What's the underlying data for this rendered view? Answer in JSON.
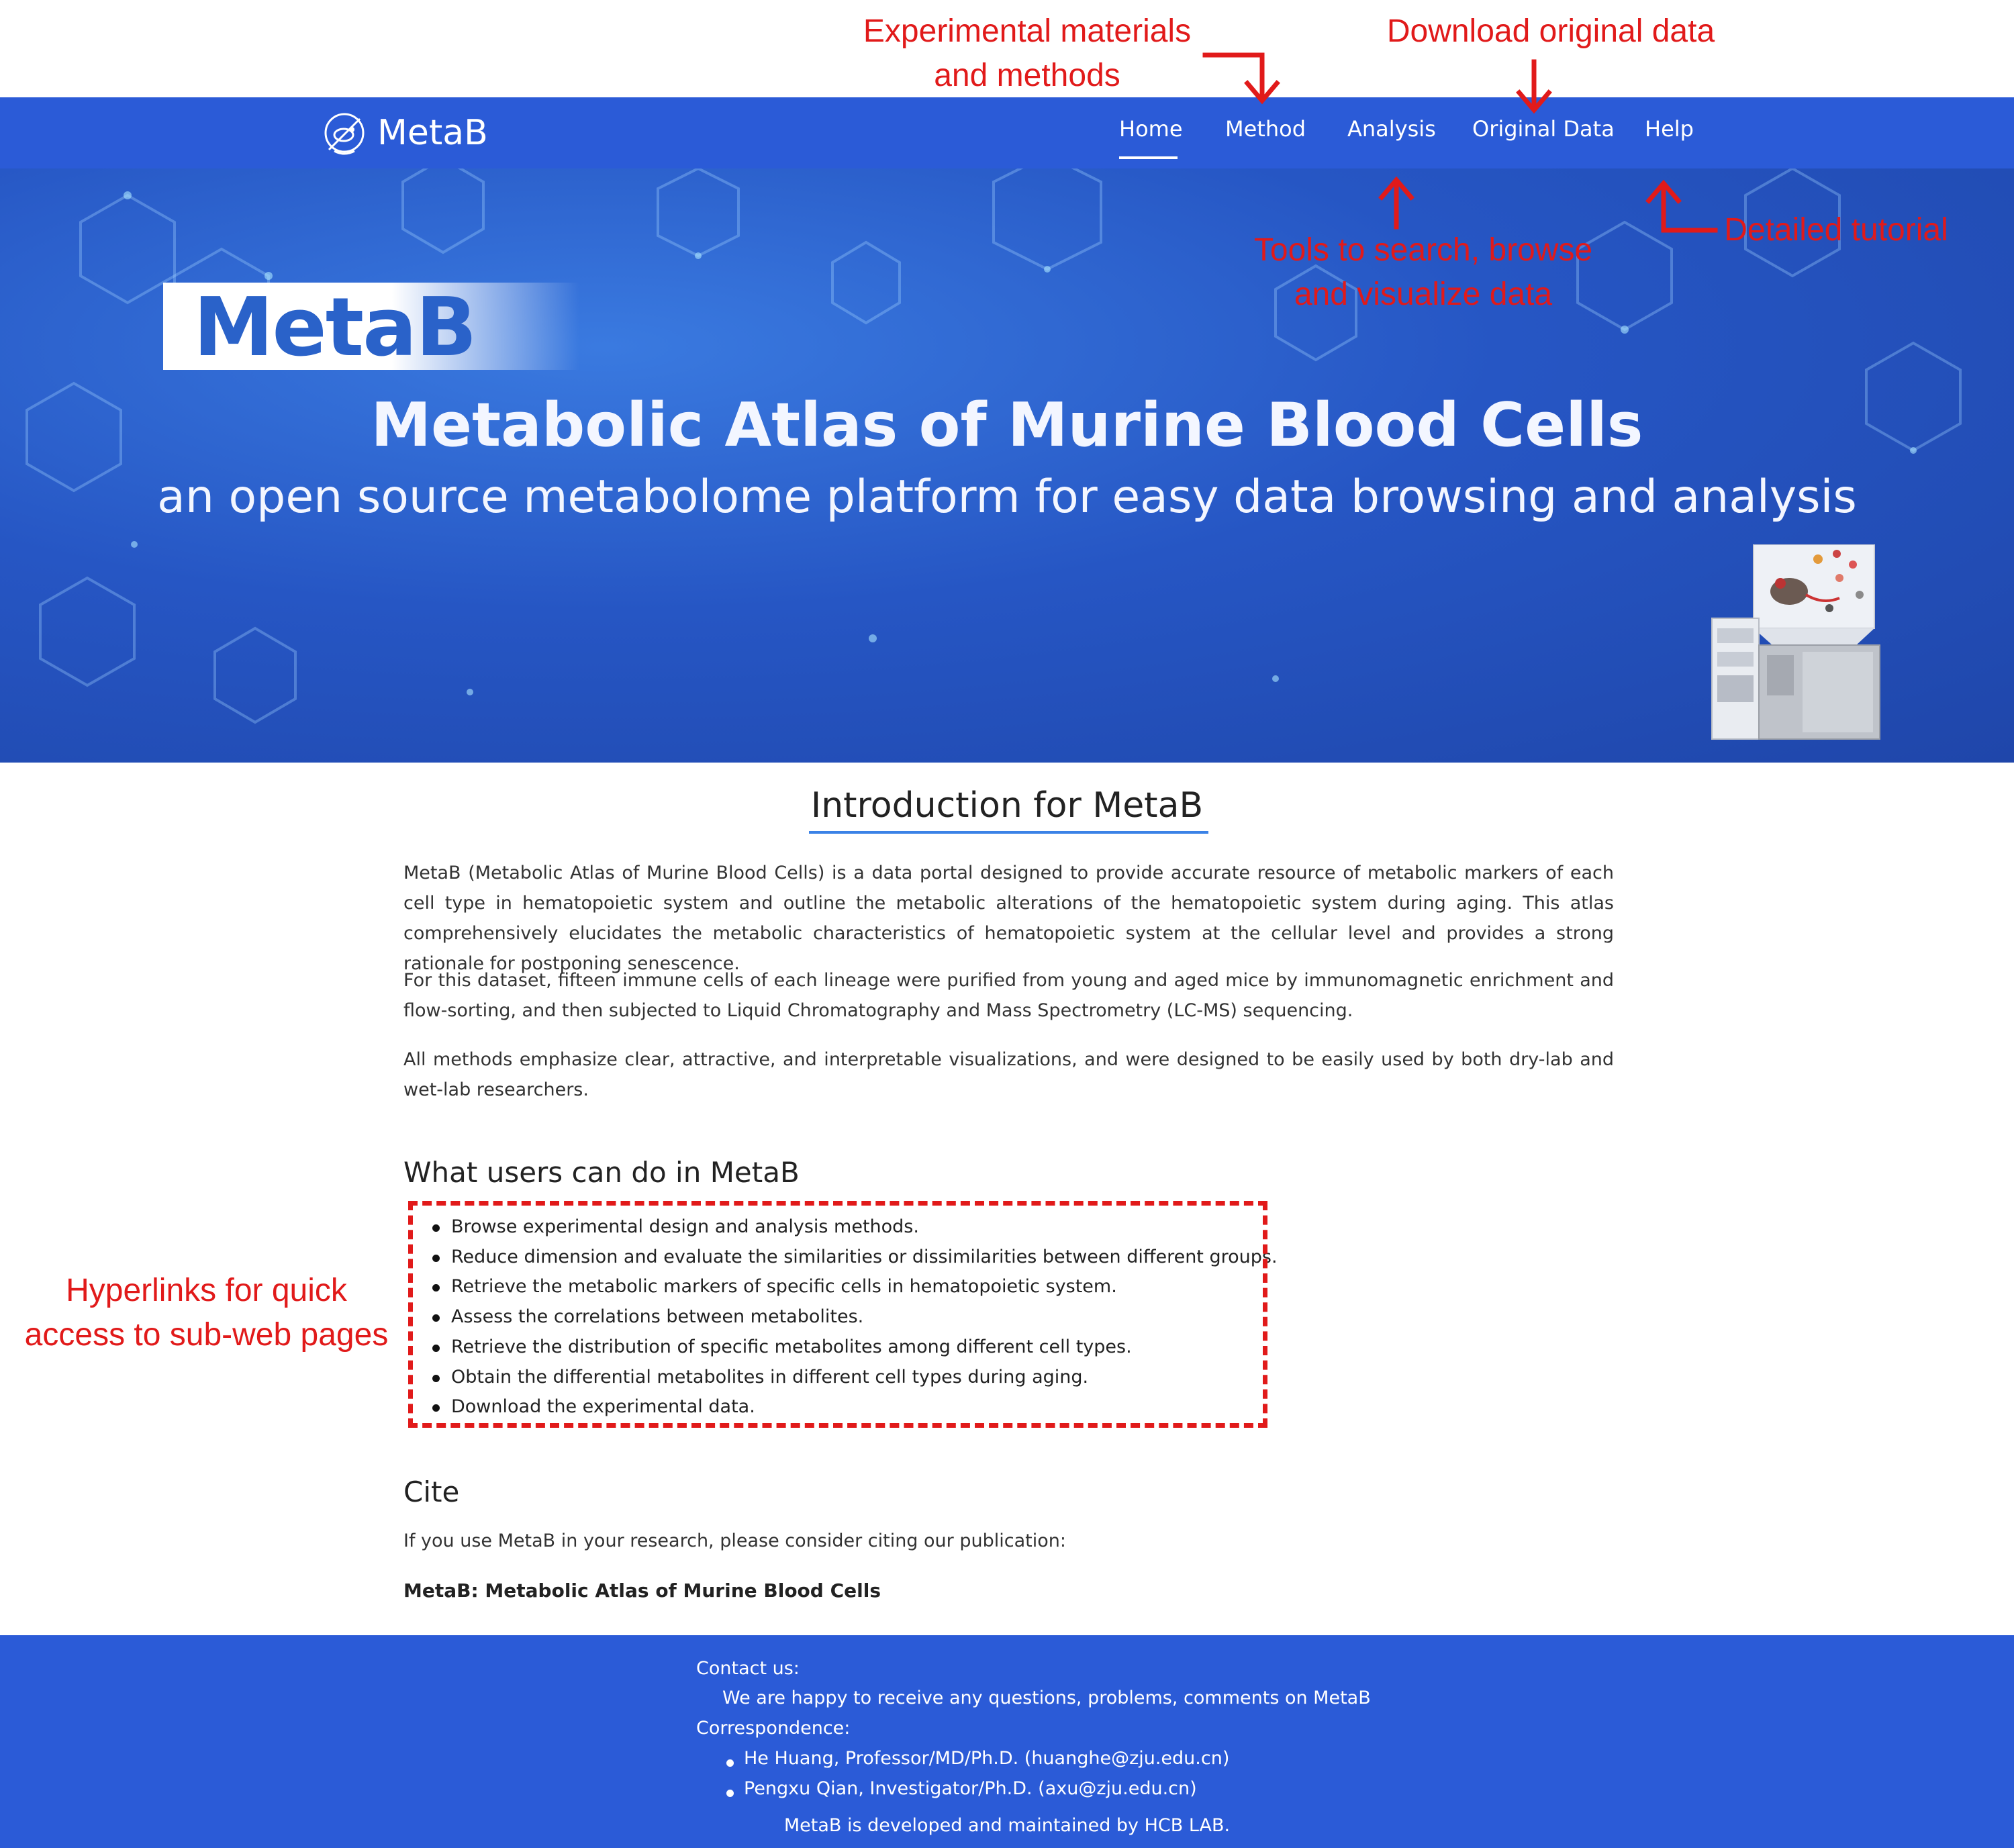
{
  "annotations": {
    "experimental": [
      "Experimental materials",
      "and methods"
    ],
    "download": "Download original data",
    "tools": [
      "Tools to search, browse",
      "and visualize data"
    ],
    "tutorial": "Detailed tutorial",
    "hyperlinks": [
      "Hyperlinks for quick",
      "access to sub-web pages"
    ],
    "color": "#e11a1a"
  },
  "navbar": {
    "brand": "MetaB",
    "brand_icon": "mouse-logo-icon",
    "items": [
      {
        "label": "Home",
        "active": true
      },
      {
        "label": "Method"
      },
      {
        "label": "Analysis"
      },
      {
        "label": "Original Data"
      },
      {
        "label": "Help"
      }
    ],
    "color": "#2b5bd7"
  },
  "hero": {
    "logo": "MetaB",
    "title": "Metabolic Atlas of Murine Blood Cells",
    "subtitle": "an open source metabolome platform for easy data browsing and analysis",
    "illustration_icon": "lab-instrument-mouse-icon"
  },
  "intro": {
    "title": "Introduction for MetaB",
    "paragraphs": [
      "MetaB (Metabolic Atlas of Murine Blood Cells) is a data portal designed to provide accurate resource of metabolic markers of each cell type in hematopoietic system and outline the metabolic alterations of the hematopoietic system during aging. This atlas comprehensively elucidates the metabolic characteristics of hematopoietic system at the cellular level and provides a strong rationale for postponing senescence.",
      "For this dataset, fifteen immune cells of each lineage were purified from young and aged mice by immunomagnetic enrichment and flow-sorting, and then subjected to Liquid Chromatography and Mass Spectrometry (LC-MS) sequencing.",
      "All methods emphasize clear, attractive, and interpretable visualizations, and were designed to be easily used by both dry-lab and wet-lab researchers."
    ]
  },
  "users": {
    "heading": "What users can do in MetaB",
    "items": [
      "Browse experimental design and analysis methods.",
      "Reduce dimension and evaluate the similarities or dissimilarities between different groups.",
      "Retrieve the metabolic markers of specific cells in hematopoietic system.",
      "Assess the correlations between metabolites.",
      "Retrieve the distribution of specific metabolites among different cell types.",
      "Obtain the differential metabolites in different cell types during aging.",
      "Download the experimental data."
    ]
  },
  "cite": {
    "heading": "Cite",
    "text": "If you use MetaB in your research, please consider citing our publication:",
    "publication": "MetaB: Metabolic Atlas of Murine Blood Cells"
  },
  "footer": {
    "contact_label": "Contact us:",
    "contact_text": "We are happy to receive any questions, problems, comments on MetaB",
    "correspondence_label": "Correspondence:",
    "people": [
      "He Huang, Professor/MD/Ph.D. (huanghe@zju.edu.cn)",
      "Pengxu Qian, Investigator/Ph.D. (axu@zju.edu.cn)"
    ],
    "developed": "MetaB is developed and maintained by HCB LAB."
  }
}
